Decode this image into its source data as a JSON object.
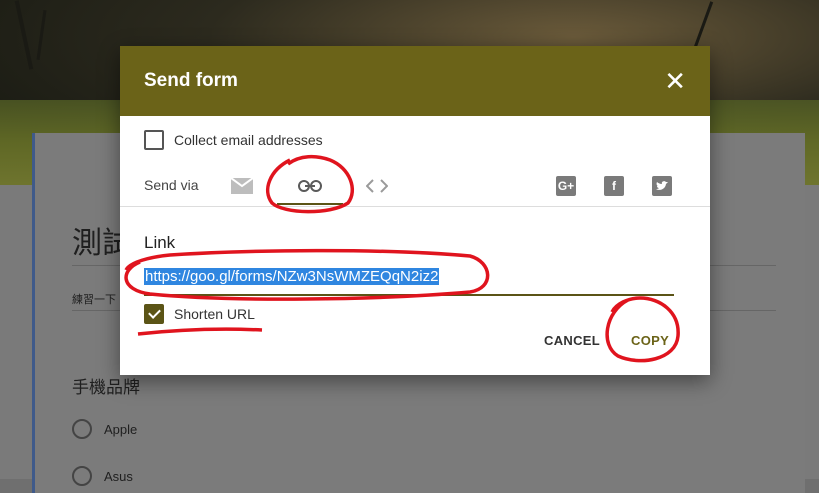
{
  "background_form": {
    "title": "測試",
    "description": "練習一下",
    "question": "手機品牌",
    "options": [
      "Apple",
      "Asus"
    ]
  },
  "dialog": {
    "title": "Send form",
    "collect_email_label": "Collect email addresses",
    "collect_email_checked": false,
    "send_via_label": "Send via",
    "tabs": [
      "mail-icon",
      "link-icon",
      "embed-icon"
    ],
    "active_tab": "link-icon",
    "share_icons": [
      "google-plus-icon",
      "facebook-icon",
      "twitter-icon"
    ],
    "link_label": "Link",
    "link_value": "https://goo.gl/forms/NZw3NsWMZEQqN2iz2",
    "shorten_label": "Shorten URL",
    "shorten_checked": true,
    "cancel_label": "CANCEL",
    "copy_label": "COPY"
  },
  "colors": {
    "header": "#6b6318",
    "accent": "#5b5416",
    "annotation": "#e0141e",
    "selection": "#2f86e0"
  }
}
